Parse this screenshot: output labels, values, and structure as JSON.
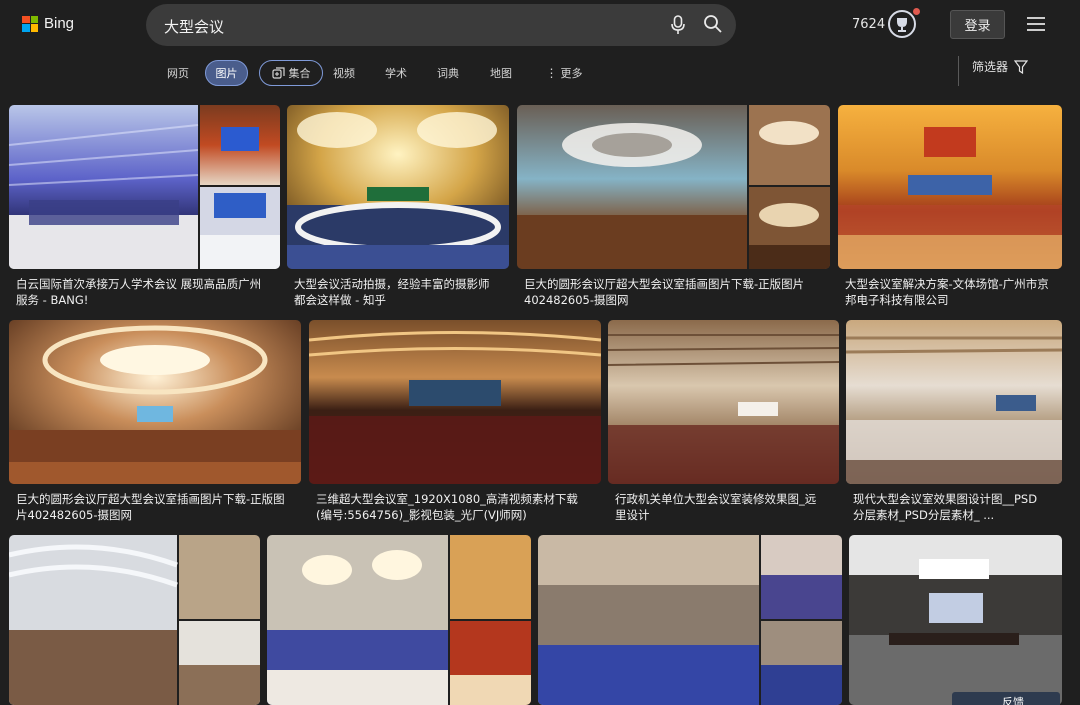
{
  "brand": {
    "logo_text": "Bing",
    "logo_colors": [
      "#f25022",
      "#7fba00",
      "#00a4ef",
      "#ffb900"
    ]
  },
  "search": {
    "query": "大型会议",
    "mic_icon": "microphone-icon",
    "search_icon": "search-icon"
  },
  "header": {
    "points": "7624",
    "reward_icon": "trophy-icon",
    "login_label": "登录",
    "menu_icon": "hamburger-menu-icon"
  },
  "nav": {
    "tabs": [
      {
        "label": "网页"
      },
      {
        "label": "图片",
        "active": true
      },
      {
        "label": "集合"
      },
      {
        "label": "视频"
      },
      {
        "label": "学术"
      },
      {
        "label": "词典"
      },
      {
        "label": "地图"
      },
      {
        "label": "更多"
      }
    ],
    "filter_label": "筛选器"
  },
  "results": [
    {
      "caption_1": "白云国际首次承接万人学术会议 展现高品质广州",
      "caption_2": "服务 - BANG!"
    },
    {
      "caption_1": "大型会议活动拍摄，经验丰富的摄影师",
      "caption_2": "都会这样做 - 知乎"
    },
    {
      "caption_1": "巨大的圆形会议厅超大型会议室插画图片下载-正版图片",
      "caption_2": "402482605-摄图网"
    },
    {
      "caption_1": "大型会议室解决方案-文体场馆-广州市京",
      "caption_2": "邦电子科技有限公司"
    },
    {
      "caption_1": "巨大的圆形会议厅超大型会议室插画图片下载-正版图",
      "caption_2": "片402482605-摄图网"
    },
    {
      "caption_1": "三维超大型会议室_1920X1080_高清视频素材下载",
      "caption_2": "(编号:5564756)_影视包装_光厂(VJ师网)"
    },
    {
      "caption_1": "行政机关单位大型会议室装修效果图_远",
      "caption_2": "里设计"
    },
    {
      "caption_1": "现代大型会议室效果图设计图__PSD",
      "caption_2": "分层素材_PSD分层素材_ ..."
    },
    {
      "caption_1": "",
      "caption_2": ""
    },
    {
      "caption_1": "",
      "caption_2": ""
    },
    {
      "caption_1": "",
      "caption_2": ""
    },
    {
      "caption_1": "",
      "caption_2": ""
    }
  ],
  "feedback_label": "反馈"
}
